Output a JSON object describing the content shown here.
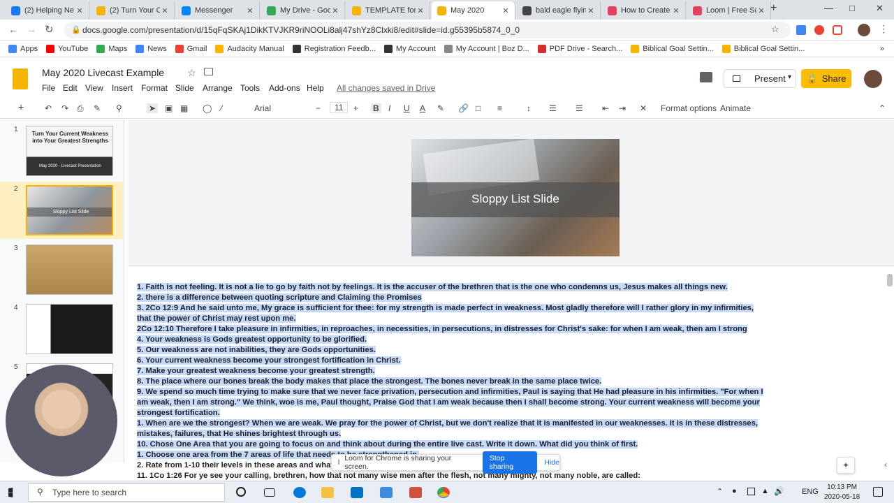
{
  "browser": {
    "tabs": [
      {
        "label": "(2) Helping Ne",
        "color": "#1877f2"
      },
      {
        "label": "(2) Turn Your C",
        "color": "#f4b400"
      },
      {
        "label": "Messenger",
        "color": "#0084ff"
      },
      {
        "label": "My Drive - Goo",
        "color": "#34a853"
      },
      {
        "label": "TEMPLATE for",
        "color": "#f4b400"
      },
      {
        "label": "May 2020",
        "color": "#f4b400"
      },
      {
        "label": "bald eagle flyin",
        "color": "#444"
      },
      {
        "label": "How to Create",
        "color": "#e4405f"
      },
      {
        "label": "Loom | Free Sc",
        "color": "#e4405f"
      }
    ],
    "new_tab": "+",
    "url": "docs.google.com/presentation/d/15qFqSKAj1DikKTVJKR9riNOOLi8alj47shYz8Clxki8/edit#slide=id.g55395b5874_0_0",
    "bookmarks": [
      {
        "label": "Apps",
        "color": "#4285f4"
      },
      {
        "label": "YouTube",
        "color": "#ff0000"
      },
      {
        "label": "Maps",
        "color": "#34a853"
      },
      {
        "label": "News",
        "color": "#4285f4"
      },
      {
        "label": "Gmail",
        "color": "#ea4335"
      },
      {
        "label": "Audacity Manual",
        "color": "#f7b500"
      },
      {
        "label": "Registration Feedb...",
        "color": "#333"
      },
      {
        "label": "My Account",
        "color": "#333"
      },
      {
        "label": "My Account | Boz D...",
        "color": "#888"
      },
      {
        "label": "PDF Drive - Search...",
        "color": "#d32f2f"
      },
      {
        "label": "Biblical Goal Settin...",
        "color": "#f4b400"
      },
      {
        "label": "Biblical Goal Settin...",
        "color": "#f4b400"
      }
    ]
  },
  "slides_app": {
    "title": "May 2020 Livecast  Example",
    "menu": [
      "File",
      "Edit",
      "View",
      "Insert",
      "Format",
      "Slide",
      "Arrange",
      "Tools",
      "Add-ons",
      "Help"
    ],
    "saved_status": "All changes saved in Drive",
    "present_label": "Present",
    "share_label": "Share",
    "toolbar": {
      "font": "Arial",
      "size": "11",
      "format_options": "Format options",
      "animate": "Animate"
    },
    "thumbnails": [
      {
        "num": "1",
        "title": "Turn Your Current Weakness into Your Greatest Strengths",
        "sub": "May 2020 - Livecast Presentation"
      },
      {
        "num": "2",
        "title": "Sloppy List Slide"
      },
      {
        "num": "3"
      },
      {
        "num": "4"
      },
      {
        "num": "5"
      }
    ],
    "slide_title": "Sloppy List Slide",
    "notes": [
      "1. Faith is not feeling. It is not a lie to go by faith not by feelings. It is the accuser of the brethren that is the one who condemns us, Jesus makes all things new.",
      "2. there is a difference between quoting scripture and Claiming the Promises",
      "3. 2Co 12:9 And he said unto me, My grace is sufficient for thee: for my strength is made perfect in weakness. Most gladly therefore will I rather glory in my infirmities,",
      "that the power of Christ may rest upon me.",
      "2Co 12:10 Therefore I take pleasure in infirmities, in reproaches, in necessities, in persecutions, in distresses for Christ's sake: for when I am weak, then am I strong",
      "4. Your weakness is Gods greatest opportunity to be glorified.",
      "5. Our weakness are not inabilities, they are Gods opportunities.",
      "6. Your current weakness become your strongest fortification in Christ.",
      "7. Make your greatest weakness become your greatest strength.",
      "8. The place where our bones break the body makes that place the strongest. The bones never break in the same place twice.",
      "9. We spend so much time trying to make sure that we never face privation, persecution and infirmities, Paul is saying that He had pleasure in his infirmities. \"For when I",
      "am weak, then I am strong.\" We think, woe is me, Paul thought, Praise God that I am weak because then I shall become strong. Your current weakness will become your",
      "strongest fortification.",
      "    1. When are we the strongest? When we are weak. We pray for the power of Christ, but we don't realize that it is manifested in our weaknesses. It is in these distresses,",
      "mistakes, failures, that He shines brightest through us.",
      "10. Chose One Area that you are going to focus on and think about during the entire live cast. Write it down. What did you think of first.",
      "    1. Choose one area from the 7 areas of life that needs to be strengthened in.",
      "    2. Rate from 1-10 their levels in these areas and what is required to getting it to a ten. ?",
      "11. 1Co 1:26 For ye see your calling, brethren, how that not many wise men after the flesh, not many mighty, not many noble, are called:"
    ]
  },
  "loom": {
    "message": "Loom for Chrome is sharing your screen.",
    "stop_label": "Stop sharing",
    "hide_label": "Hide"
  },
  "taskbar": {
    "search_placeholder": "Type here to search",
    "language": "ENG",
    "time": "10:13 PM",
    "date": "2020-05-18"
  }
}
